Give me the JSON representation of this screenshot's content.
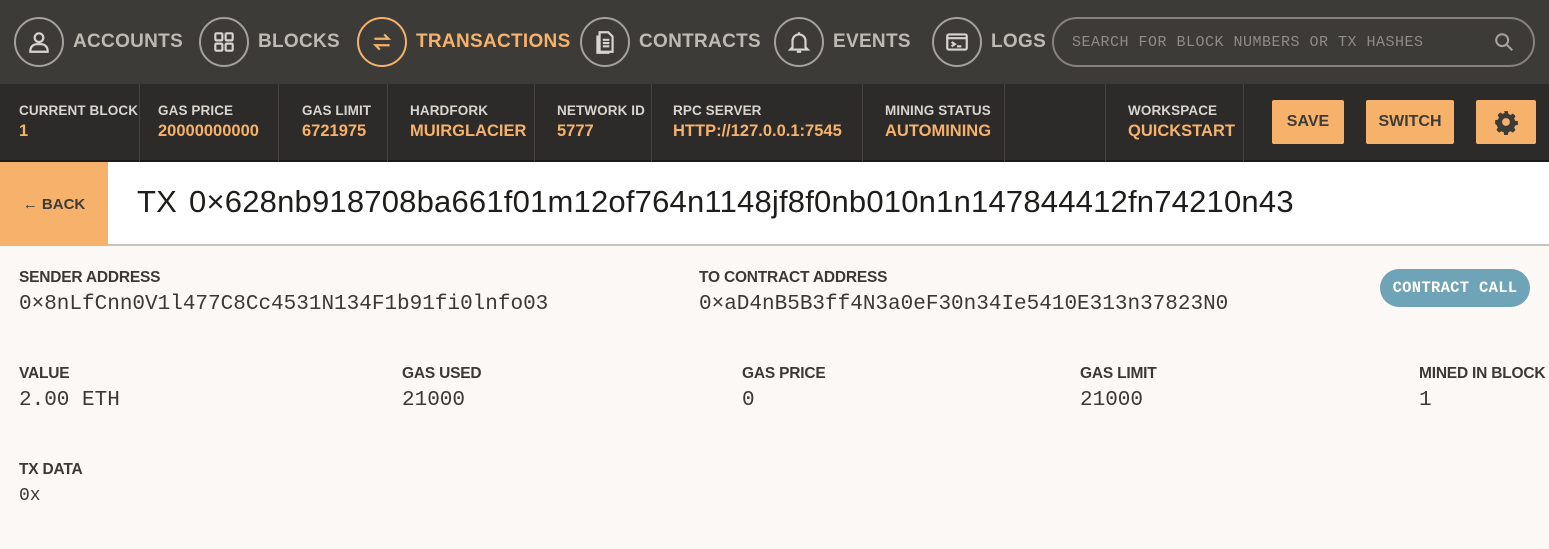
{
  "nav": {
    "items": [
      {
        "label": "ACCOUNTS",
        "icon": "account-icon"
      },
      {
        "label": "BLOCKS",
        "icon": "blocks-icon"
      },
      {
        "label": "TRANSACTIONS",
        "icon": "transactions-icon",
        "active": true
      },
      {
        "label": "CONTRACTS",
        "icon": "contracts-icon"
      },
      {
        "label": "EVENTS",
        "icon": "bell-icon"
      },
      {
        "label": "LOGS",
        "icon": "terminal-icon"
      }
    ],
    "search_placeholder": "SEARCH FOR BLOCK NUMBERS OR TX HASHES"
  },
  "status": {
    "current_block": {
      "label": "CURRENT BLOCK",
      "value": "1"
    },
    "gas_price": {
      "label": "GAS PRICE",
      "value": "20000000000"
    },
    "gas_limit": {
      "label": "GAS LIMIT",
      "value": "6721975"
    },
    "hardfork": {
      "label": "HARDFORK",
      "value": "MUIRGLACIER"
    },
    "network_id": {
      "label": "NETWORK ID",
      "value": "5777"
    },
    "rpc_server": {
      "label": "RPC SERVER",
      "value": "HTTP://127.0.0.1:7545"
    },
    "mining_status": {
      "label": "MINING STATUS",
      "value": "AUTOMINING"
    },
    "workspace": {
      "label": "WORKSPACE",
      "value": "QUICKSTART"
    },
    "save_label": "SAVE",
    "switch_label": "SWITCH",
    "settings_icon": "gear-icon"
  },
  "title": {
    "back_label": "← BACK",
    "prefix": "TX",
    "hash": "0×628nb918708ba661f01m12of764n1148jf8f0nb010n1n147844412fn74210n43"
  },
  "details": {
    "sender": {
      "label": "SENDER ADDRESS",
      "value": "0×8nLfCnn0V1l477C8Cc4531N134F1b91fi0lnfo03"
    },
    "to_contract": {
      "label": "TO CONTRACT ADDRESS",
      "value": "0×aD4nB5B3ff4N3a0eF30n34Ie5410E313n37823N0"
    },
    "type_badge": "CONTRACT CALL",
    "value": {
      "label": "VALUE",
      "value": "2.00 ETH"
    },
    "gas_used": {
      "label": "GAS USED",
      "value": "21000"
    },
    "gas_price": {
      "label": "GAS PRICE",
      "value": "0"
    },
    "gas_limit": {
      "label": "GAS LIMIT",
      "value": "21000"
    },
    "mined_in_block": {
      "label": "MINED IN BLOCK",
      "value": "1"
    },
    "tx_data": {
      "label": "TX DATA",
      "value": "0x"
    }
  },
  "colors": {
    "accent": "#f6b26b",
    "nav_bg": "#3d3b38",
    "status_bg": "#2c2b29",
    "badge": "#6fa3b7"
  }
}
